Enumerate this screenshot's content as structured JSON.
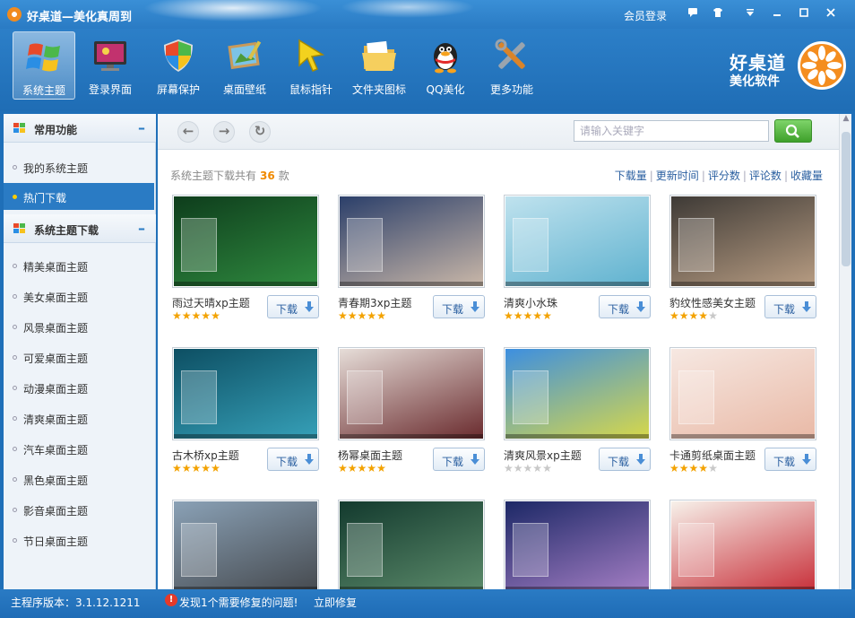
{
  "window": {
    "title": "好桌道—美化真周到",
    "member_login": "会员登录",
    "controls": [
      "chat-icon",
      "skin-icon",
      "menu-icon",
      "minimize-icon",
      "maximize-icon",
      "close-icon"
    ]
  },
  "toolbar": {
    "items": [
      {
        "label": "系统主题",
        "icon": "windows-flag-icon",
        "active": true
      },
      {
        "label": "登录界面",
        "icon": "monitor-icon",
        "active": false
      },
      {
        "label": "屏幕保护",
        "icon": "shield-icon",
        "active": false
      },
      {
        "label": "桌面壁纸",
        "icon": "wallpaper-icon",
        "active": false
      },
      {
        "label": "鼠标指针",
        "icon": "cursor-icon",
        "active": false
      },
      {
        "label": "文件夹图标",
        "icon": "folder-icon",
        "active": false
      },
      {
        "label": "QQ美化",
        "icon": "qq-penguin-icon",
        "active": false
      },
      {
        "label": "更多功能",
        "icon": "tools-icon",
        "active": false
      }
    ],
    "brand_line1": "好桌道",
    "brand_line2": "美化软件"
  },
  "sidebar": {
    "section1": {
      "title": "常用功能",
      "collapse": "–"
    },
    "section1_items": [
      {
        "label": "我的系统主题",
        "active": false
      },
      {
        "label": "热门下载",
        "active": true
      }
    ],
    "section2": {
      "title": "系统主题下载",
      "collapse": "–"
    },
    "section2_items": [
      {
        "label": "精美桌面主题"
      },
      {
        "label": "美女桌面主题"
      },
      {
        "label": "风景桌面主题"
      },
      {
        "label": "可爱桌面主题"
      },
      {
        "label": "动漫桌面主题"
      },
      {
        "label": "清爽桌面主题"
      },
      {
        "label": "汽车桌面主题"
      },
      {
        "label": "黑色桌面主题"
      },
      {
        "label": "影音桌面主题"
      },
      {
        "label": "节日桌面主题"
      }
    ]
  },
  "main": {
    "search": {
      "placeholder": "请输入关键字",
      "value": ""
    },
    "summary_prefix": "系统主题下载共有",
    "summary_count": "36",
    "summary_suffix": "款",
    "sort_links": [
      "下载量",
      "更新时间",
      "评分数",
      "评论数",
      "收藏量"
    ],
    "download_label": "下载",
    "themes": [
      {
        "name": "雨过天晴xp主题",
        "rating": 5,
        "colors": [
          "#0e3d1c",
          "#2f8a3f"
        ]
      },
      {
        "name": "青春期3xp主题",
        "rating": 4.5,
        "colors": [
          "#2b3f6a",
          "#c9b7a8"
        ]
      },
      {
        "name": "清爽小水珠",
        "rating": 4.5,
        "colors": [
          "#bfe2ee",
          "#5fb2cf"
        ]
      },
      {
        "name": "豹纹性感美女主题",
        "rating": 3.5,
        "colors": [
          "#3e3a36",
          "#b79c82"
        ]
      },
      {
        "name": "古木桥xp主题",
        "rating": 5,
        "colors": [
          "#0d4f63",
          "#36a0b8"
        ]
      },
      {
        "name": "杨幂桌面主题",
        "rating": 5,
        "colors": [
          "#e6ddd8",
          "#6a2b2e"
        ]
      },
      {
        "name": "清爽风景xp主题",
        "rating": 0,
        "colors": [
          "#3d8fe0",
          "#d7d84a"
        ]
      },
      {
        "name": "卡通剪纸桌面主题",
        "rating": 4,
        "colors": [
          "#f6e8e2",
          "#e9b9a6"
        ]
      },
      {
        "name": "",
        "rating": null,
        "colors": [
          "#8aa1b6",
          "#464a4f"
        ]
      },
      {
        "name": "",
        "rating": null,
        "colors": [
          "#133a2e",
          "#5b8a6a"
        ]
      },
      {
        "name": "",
        "rating": null,
        "colors": [
          "#1c2866",
          "#a47ec4"
        ]
      },
      {
        "name": "",
        "rating": null,
        "colors": [
          "#f7f1ea",
          "#c8303a"
        ]
      }
    ]
  },
  "status": {
    "version": "主程序版本：3.1.12.1211",
    "warning_mark": "!",
    "warning": "发现1个需要修复的问题!",
    "fix_now": "立即修复"
  }
}
